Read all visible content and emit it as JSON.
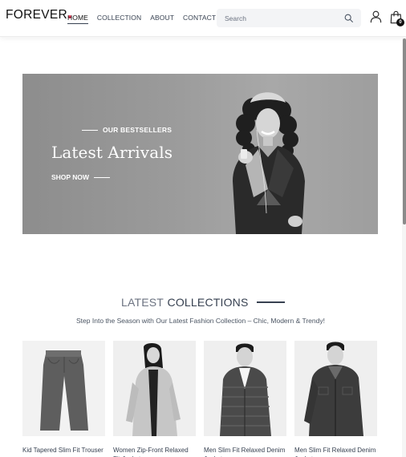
{
  "header": {
    "logo": "FOREVER",
    "nav": [
      "HOME",
      "COLLECTION",
      "ABOUT",
      "CONTACT"
    ],
    "active_nav": "HOME",
    "search_placeholder": "Search",
    "cart_count": "0"
  },
  "hero": {
    "eyebrow": "OUR BESTSELLERS",
    "title": "Latest Arrivals",
    "cta": "SHOP NOW"
  },
  "latest": {
    "title_light": "LATEST",
    "title_dark": "COLLECTIONS",
    "subtitle": "Step Into the Season with Our Latest Fashion Collection – Chic, Modern & Trendy!"
  },
  "products": [
    {
      "name": "Kid Tapered Slim Fit Trouser",
      "image": "jeans"
    },
    {
      "name": "Women Zip-Front Relaxed Fit Jacket",
      "image": "women-jacket"
    },
    {
      "name": "Men Slim Fit Relaxed Denim Jacket",
      "image": "puffer-jacket"
    },
    {
      "name": "Men Slim Fit Relaxed Denim Jacket",
      "image": "denim-jacket"
    }
  ],
  "colors": {
    "accent_dot": "#f43f5e",
    "text": "#374151",
    "hero_bg": "#9a9a9a"
  }
}
